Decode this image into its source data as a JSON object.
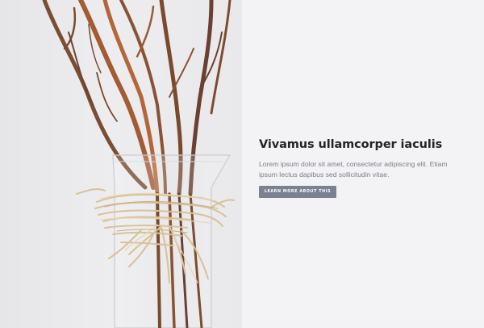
{
  "hero": {
    "title": "Vivamus ullamcorper iaculis",
    "body": "Lorem ipsum dolor sit amet, consectetur adipiscing elit. Etiam ipsum lectus dapibus sed sollicitudin vitae.",
    "cta_label": "LEARN MORE ABOUT THIS"
  },
  "colors": {
    "background": "#f3f3f5",
    "title": "#23232b",
    "body_text": "#7c7f88",
    "button": "#7a8190",
    "button_text": "#ffffff"
  }
}
